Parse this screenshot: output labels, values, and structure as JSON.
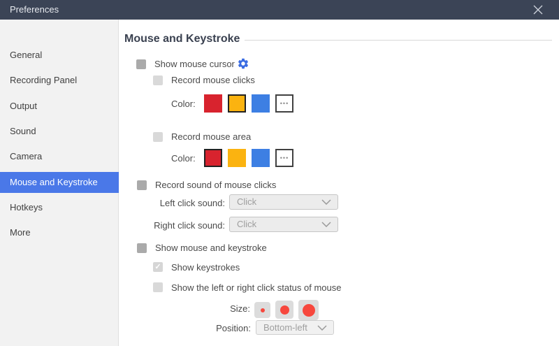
{
  "window": {
    "title": "Preferences",
    "close_icon": "close"
  },
  "sidebar": {
    "items": [
      "General",
      "Recording Panel",
      "Output",
      "Sound",
      "Camera",
      "Mouse and Keystroke",
      "Hotkeys",
      "More"
    ],
    "selected": "Mouse and Keystroke"
  },
  "content": {
    "heading": "Mouse and Keystroke",
    "show_mouse_cursor_label": "Show mouse cursor",
    "record_mouse_clicks_label": "Record mouse clicks",
    "color_label_1": "Color:",
    "record_mouse_area_label": "Record mouse area",
    "color_label_2": "Color:",
    "record_sound_label": "Record sound of mouse clicks",
    "left_click_sound_label": "Left click sound:",
    "left_click_sound_value": "Click",
    "right_click_sound_label": "Right click sound:",
    "right_click_sound_value": "Click",
    "show_mouse_keystroke_label": "Show mouse and keystroke",
    "show_keystrokes_label": "Show keystrokes",
    "show_keystrokes_check": "✓",
    "show_click_status_label": "Show the left or right click status of mouse",
    "size_label": "Size:",
    "position_label": "Position:",
    "position_value": "Bottom-left",
    "more_button_label": "•••"
  },
  "colors": {
    "titlebar_bg": "#3b4456",
    "sidebar_selected_bg": "#4a78e8",
    "swatch_red": "#d8232e",
    "swatch_orange": "#fbb310",
    "swatch_blue": "#3d7fe3",
    "size_dot_red": "#f7473d",
    "gear_blue": "#3a6ce2"
  }
}
